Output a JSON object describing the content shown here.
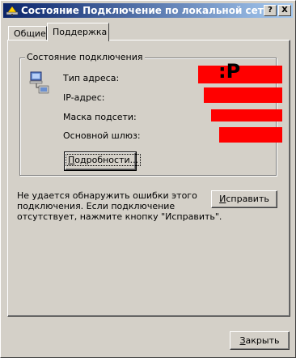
{
  "window": {
    "title": "Состояние Подключение по локальной сети",
    "help_button": "?",
    "close_button": "X"
  },
  "tabs": [
    {
      "label": "Общие",
      "active": false
    },
    {
      "label": "Поддержка",
      "active": true
    }
  ],
  "connection_status": {
    "group_title": "Состояние подключения",
    "fields": [
      {
        "label": "Тип адреса:"
      },
      {
        "label": "IP-адрес:"
      },
      {
        "label": "Маска подсети:"
      },
      {
        "label": "Основной шлюз:"
      }
    ],
    "redaction_mark": ":P",
    "redaction_color": "#ff0000",
    "details_button_pre": "",
    "details_button_accel": "П",
    "details_button_post": "одробности..."
  },
  "message": {
    "lines": [
      "Не удается обнаружить ошибки этого",
      "подключения. Если подключение",
      "отсутствует, нажмите кнопку \"Исправить\"."
    ]
  },
  "repair_button": {
    "pre": "",
    "accel": "И",
    "post": "справить"
  },
  "close_button": {
    "pre": "",
    "accel": "З",
    "post": "акрыть"
  },
  "colors": {
    "titlebar_start": "#0a246a",
    "titlebar_end": "#a6caf0",
    "face": "#d4d0c8"
  }
}
